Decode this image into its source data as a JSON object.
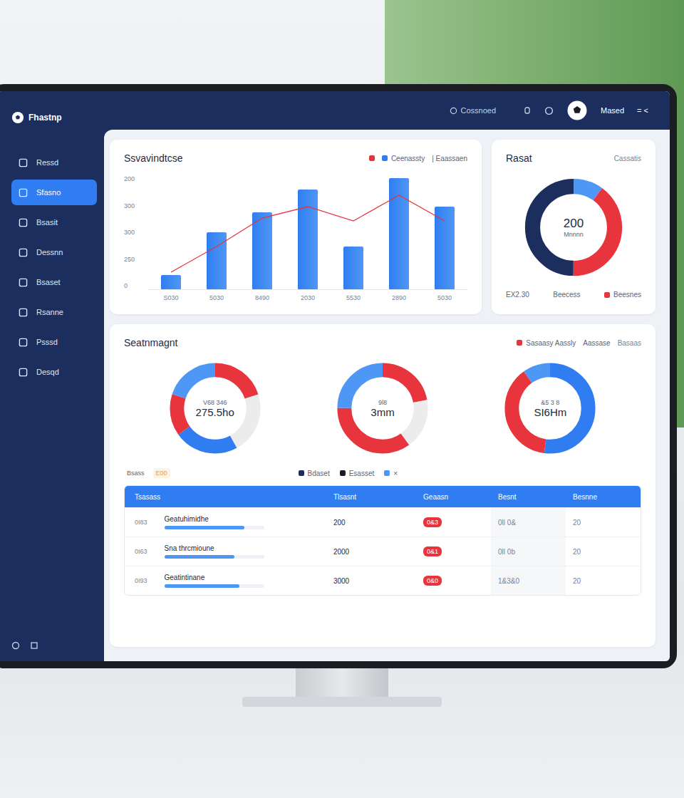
{
  "logo": "Fhastnp",
  "header": {
    "search": "Cossnoed",
    "user": "Mased",
    "close": "= <"
  },
  "sidebar": {
    "items": [
      {
        "label": "Ressd",
        "selected": false
      },
      {
        "label": "Sfasno",
        "selected": true
      },
      {
        "label": "Bsasit",
        "selected": false
      },
      {
        "label": "Dessnn",
        "selected": false
      },
      {
        "label": "Bsaset",
        "selected": false
      },
      {
        "label": "Rsanne",
        "selected": false
      },
      {
        "label": "Psssd",
        "selected": false
      },
      {
        "label": "Desqd",
        "selected": false
      }
    ]
  },
  "performance": {
    "title": "Ssvavindtcse",
    "legend": [
      {
        "label": "",
        "color": "#e8343c"
      },
      {
        "label": "Ceenassty",
        "color": "#2f7df0"
      }
    ],
    "extra": "Eaassaen",
    "y_ticks": [
      "200",
      "300",
      "300",
      "250",
      "0"
    ],
    "x_labels": [
      "S030",
      "5030",
      "8490",
      "2030",
      "5530",
      "2890",
      "5030"
    ],
    "max": 400,
    "bars": [
      50,
      200,
      270,
      350,
      150,
      390,
      290
    ],
    "line": [
      60,
      150,
      250,
      290,
      240,
      330,
      240
    ]
  },
  "result": {
    "title": "Rasat",
    "subtitle": "Cassatis",
    "value": "200",
    "unit": "Mnnnn",
    "segments": [
      {
        "share": 0.1,
        "color": "#4f97f5"
      },
      {
        "share": 0.4,
        "color": "#e8343c"
      },
      {
        "share": 0.5,
        "color": "#1b2e5e"
      }
    ],
    "footer": [
      {
        "label": "EX2.30",
        "color": ""
      },
      {
        "label": "Beecess",
        "color": ""
      },
      {
        "label": "Beesnes",
        "color": "#e8343c"
      }
    ]
  },
  "segments": {
    "title": "Seatnmagnt",
    "legend": [
      {
        "label": "Sasaasy Aassly",
        "color": "#e8343c"
      },
      {
        "label": "Aassase",
        "color": ""
      }
    ],
    "link": "Basaas",
    "donuts": [
      {
        "top": "V68 346",
        "value": "275.5ho",
        "segments": [
          {
            "share": 0.2,
            "color": "#e8343c"
          },
          {
            "share": 0.22,
            "color": "#ececec"
          },
          {
            "share": 0.23,
            "color": "#2f7df0"
          },
          {
            "share": 0.15,
            "color": "#e8343c"
          },
          {
            "share": 0.2,
            "color": "#4f97f5"
          }
        ]
      },
      {
        "top": "9l8",
        "value": "3mm",
        "segments": [
          {
            "share": 0.22,
            "color": "#e8343c"
          },
          {
            "share": 0.18,
            "color": "#ececec"
          },
          {
            "share": 0.35,
            "color": "#e8343c"
          },
          {
            "share": 0.25,
            "color": "#4f97f5"
          }
        ]
      },
      {
        "top": "&5 3 8",
        "value": "SI6Hm",
        "segments": [
          {
            "share": 0.52,
            "color": "#2f7df0"
          },
          {
            "share": 0.38,
            "color": "#e8343c"
          },
          {
            "share": 0.1,
            "color": "#4f97f5"
          }
        ]
      }
    ],
    "notes": [
      {
        "label": "Bsass",
        "color": ""
      },
      {
        "label": "E00",
        "color": "#e8a23c"
      }
    ],
    "keys": [
      {
        "label": "Bdaset",
        "color": "#1b2e5e"
      },
      {
        "label": "Esasset",
        "color": "#1a1c22"
      },
      {
        "label": "×",
        "color": "#4f97f5"
      }
    ]
  },
  "table": {
    "columns": [
      "Tsasass",
      "Tlsasnt",
      "Geaasn",
      "Besnt",
      "Besnne"
    ],
    "rows": [
      {
        "id": "0I83",
        "name": "Geatuhimidhe",
        "level": 0.8,
        "amount": "200",
        "badge": "0&3",
        "date": "0ll 0&",
        "count": "20"
      },
      {
        "id": "0I63",
        "name": "Sna thrcmioune",
        "level": 0.7,
        "amount": "2000",
        "badge": "0&1",
        "date": "0ll 0b",
        "count": "20"
      },
      {
        "id": "0I93",
        "name": "Geatintinane",
        "level": 0.75,
        "amount": "3000",
        "badge": "0&0",
        "date": "1&3&0",
        "count": "20"
      }
    ]
  }
}
